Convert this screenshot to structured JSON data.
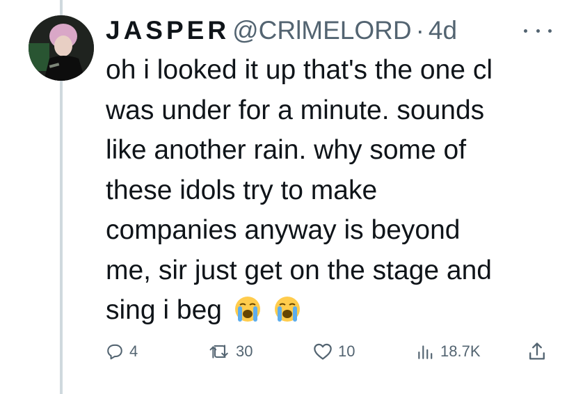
{
  "tweet": {
    "display_name": "JASPER",
    "handle": "@CRlMELORD",
    "separator": "·",
    "time": "4d",
    "text_lines": [
      "oh i looked it up that's the one cl",
      "was under for a minute. sounds",
      "like another rain. why some of",
      "these idols try to make",
      "companies anyway is beyond",
      "me, sir just get on the stage and",
      "sing i beg"
    ],
    "emojis": [
      "loudly-crying-face",
      "loudly-crying-face"
    ]
  },
  "actions": {
    "replies": "4",
    "retweets": "30",
    "likes": "10",
    "views": "18.7K"
  },
  "icons": {
    "reply": "reply-icon",
    "retweet": "retweet-icon",
    "like": "heart-icon",
    "views": "views-icon",
    "share": "share-icon",
    "more": "more-icon"
  },
  "colors": {
    "text": "#0f1419",
    "secondary": "#536471",
    "thread_line": "#cfd9de",
    "emoji_face": "#ffcc4d",
    "emoji_tears": "#5dadec"
  }
}
